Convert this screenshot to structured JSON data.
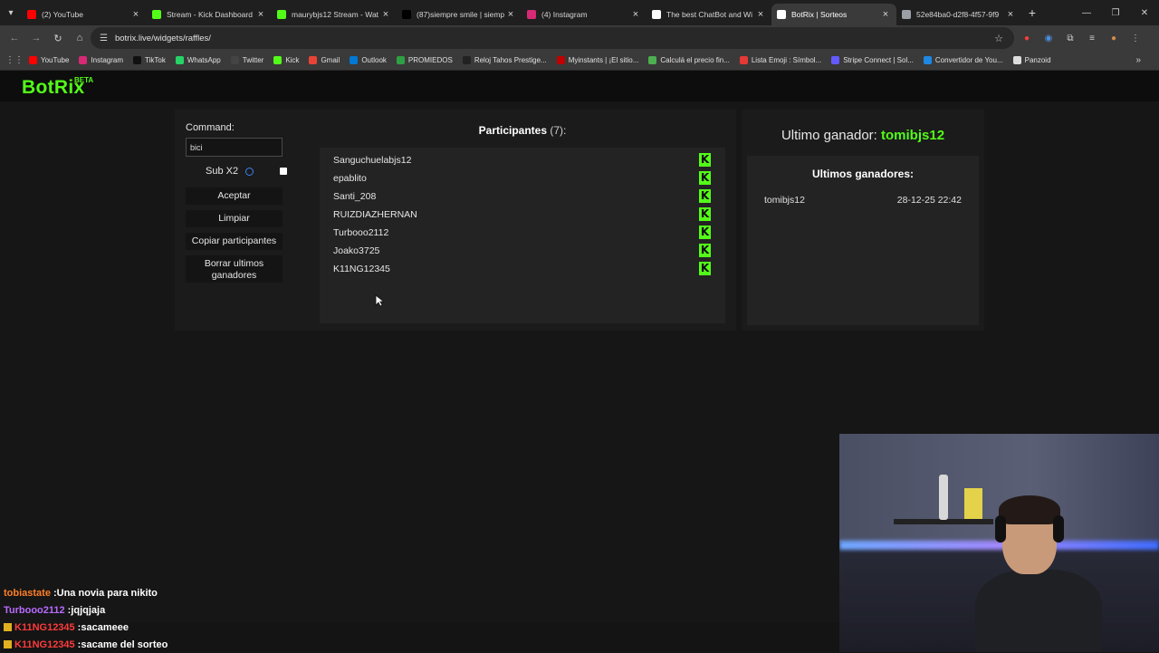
{
  "browser": {
    "tabs": [
      {
        "title": "(2) YouTube",
        "color": "#ff0000",
        "active": false
      },
      {
        "title": "Stream - Kick Dashboard",
        "color": "#53fc18",
        "active": false
      },
      {
        "title": "maurybjs12 Stream - Wat",
        "color": "#53fc18",
        "active": false
      },
      {
        "title": "(87)siempre smile | siemp",
        "color": "#000000",
        "active": false
      },
      {
        "title": "(4) Instagram",
        "color": "#d62976",
        "active": false
      },
      {
        "title": "The best ChatBot and Wi",
        "color": "#ffffff",
        "active": false
      },
      {
        "title": "BotRix | Sorteos",
        "color": "#ffffff",
        "active": true
      },
      {
        "title": "52e84ba0-d2f8-4f57-9f9",
        "color": "#9aa0a6",
        "active": false
      }
    ],
    "url": "botrix.live/widgets/raffles/",
    "bookmarks": [
      {
        "label": "YouTube",
        "color": "#ff0000"
      },
      {
        "label": "Instagram",
        "color": "#d62976"
      },
      {
        "label": "TikTok",
        "color": "#111111"
      },
      {
        "label": "WhatsApp",
        "color": "#25d366"
      },
      {
        "label": "Twitter",
        "color": "#444444"
      },
      {
        "label": "Kick",
        "color": "#53fc18"
      },
      {
        "label": "Gmail",
        "color": "#ea4335"
      },
      {
        "label": "Outlook",
        "color": "#0078d4"
      },
      {
        "label": "PROMIEDOS",
        "color": "#2ea043"
      },
      {
        "label": "Reloj Tahos Prestige...",
        "color": "#222222"
      },
      {
        "label": "Myinstants | ¡El sitio...",
        "color": "#c00000"
      },
      {
        "label": "Calculá el precio fin...",
        "color": "#4caf50"
      },
      {
        "label": "Lista Emoji : Símbol...",
        "color": "#e53935"
      },
      {
        "label": "Stripe Connect | Sol...",
        "color": "#635bff"
      },
      {
        "label": "Convertidor de You...",
        "color": "#1e88e5"
      },
      {
        "label": "Panzoid",
        "color": "#dddddd"
      }
    ]
  },
  "app": {
    "logo": "BotRix",
    "logo_badge": "BETA",
    "accent": "#53fc18"
  },
  "raffle": {
    "command_label": "Command:",
    "command_value": "bici",
    "sub_label": "Sub X2",
    "buttons": {
      "accept": "Aceptar",
      "clear": "Limpiar",
      "copy": "Copiar participantes",
      "delete_winners": "Borrar ultimos ganadores"
    },
    "participants_title": "Participantes",
    "participants_count": "(7):",
    "participants": [
      "Sanguchuelabjs12",
      "epablito",
      "Santi_208",
      "RUIZDIAZHERNAN",
      "Turbooo2112",
      "Joako3725",
      "K11NG12345"
    ],
    "platform_icon_letter": "K",
    "last_winner_label": "Ultimo ganador:",
    "last_winner_name": "tomibjs12",
    "winners_title": "Ultimos ganadores:",
    "winners": [
      {
        "name": "tomibjs12",
        "date": "28-12-25 22:42"
      }
    ]
  },
  "chat": [
    {
      "user": "tobiastate",
      "color": "#ff7f27",
      "message": "Una novia para nikito",
      "badge": false
    },
    {
      "user": "Turbooo2112",
      "color": "#b86bff",
      "message": "jqjqjaja",
      "badge": false
    },
    {
      "user": "K11NG12345",
      "color": "#ff3b3b",
      "message": "sacameee",
      "badge": true
    },
    {
      "user": "K11NG12345",
      "color": "#ff3b3b",
      "message": "sacame del sorteo",
      "badge": true
    }
  ]
}
